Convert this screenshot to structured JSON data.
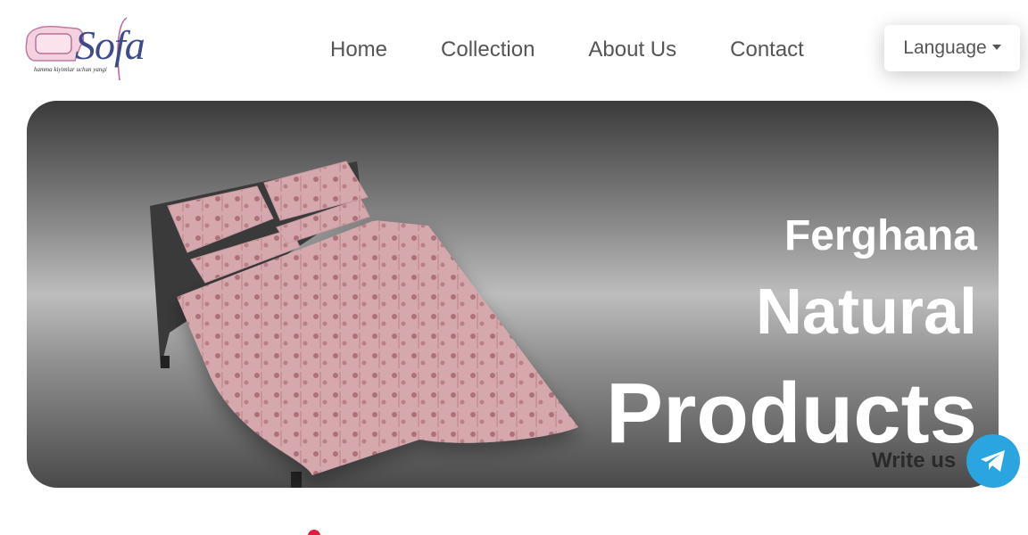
{
  "logo": {
    "text": "Sofa",
    "tagline": "hamma kiyimlar uchun yangi"
  },
  "nav": {
    "items": [
      {
        "label": "Home"
      },
      {
        "label": "Collection"
      },
      {
        "label": "About Us"
      },
      {
        "label": "Contact"
      }
    ]
  },
  "language_button": {
    "label": "Language"
  },
  "hero": {
    "line1": "Ferghana",
    "line2": "Natural",
    "line3": "Products"
  },
  "contact_widget": {
    "label": "Write us",
    "icon": "telegram-icon",
    "color": "#2aa5e0"
  }
}
